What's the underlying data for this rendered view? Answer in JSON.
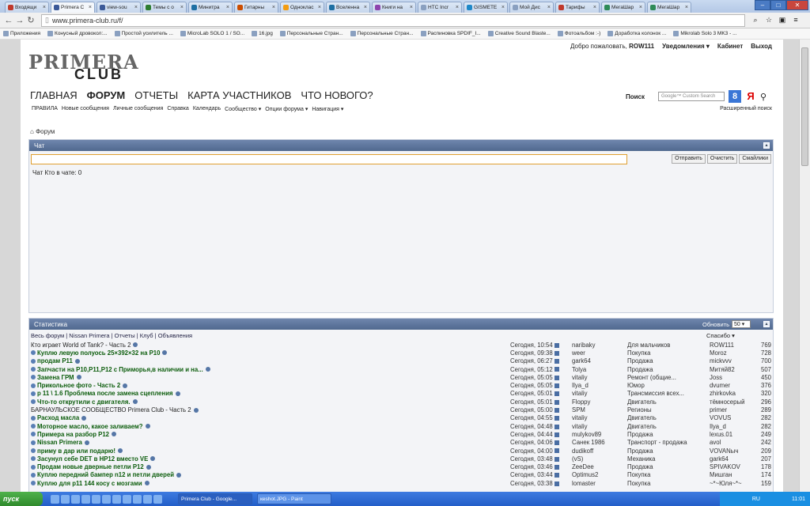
{
  "browser": {
    "tabs": [
      {
        "label": "Входящи",
        "color": "#c0392b"
      },
      {
        "label": "Primera C",
        "color": "#3b5998",
        "active": true
      },
      {
        "label": "view-sou",
        "color": "#3b5998"
      },
      {
        "label": "Темы с о",
        "color": "#2e7d32"
      },
      {
        "label": "Минитра",
        "color": "#1e6fa3"
      },
      {
        "label": "Гитарны",
        "color": "#cc4d00"
      },
      {
        "label": "Одноклас",
        "color": "#f39c12"
      },
      {
        "label": "Вселенна",
        "color": "#1e6fa3"
      },
      {
        "label": "Книги на",
        "color": "#8e44ad"
      },
      {
        "label": "HTC Incr",
        "color": "#8aa0c0"
      },
      {
        "label": "GISMETE",
        "color": "#1e88c8"
      },
      {
        "label": "Мой Дис",
        "color": "#8aa0c0"
      },
      {
        "label": "Тарифы",
        "color": "#c0392b"
      },
      {
        "label": "МегаШар",
        "color": "#2e8b57"
      },
      {
        "label": "МегаШар",
        "color": "#2e8b57"
      }
    ],
    "url": "www.primera-club.ru/f/",
    "bookmarks": [
      "Приложения",
      "Конусный дровокол:...",
      "Простой усилитель ...",
      "MicroLab SOLO 1 / SO...",
      "16.jpg",
      "Персональные Стран...",
      "Персональные Стран...",
      "Распиновка SPDIF_I...",
      "Creative Sound Blaste...",
      "Фотоальбом :-)",
      "Доработка колонок ...",
      "Mikrolab Solo 3 MK3 - ..."
    ]
  },
  "site": {
    "logo_top": "PRIMERA",
    "logo_bottom": "CLUB",
    "welcome": "Добро пожаловать,",
    "username": "ROW111",
    "notifications": "Уведомления ▾",
    "cabinet": "Кабинет",
    "logout": "Выход",
    "main_nav": [
      "ГЛАВНАЯ",
      "ФОРУМ",
      "ОТЧЕТЫ",
      "КАРТА УЧАСТНИКОВ",
      "ЧТО НОВОГО?"
    ],
    "sub_nav": [
      "ПРАВИЛА",
      "Новые сообщения",
      "Личные сообщения",
      "Справка",
      "Календарь",
      "Сообщество ▾",
      "Опции форума ▾",
      "Навигация ▾"
    ],
    "search_label": "Поиск",
    "search_placeholder": "Google™ Custom Search",
    "advanced_search": "Расширенный поиск",
    "breadcrumb": "Форум"
  },
  "chat": {
    "title": "Чат",
    "send": "Отправить",
    "clear": "Очистить",
    "smilies": "Смайлики",
    "info": "Чат     Кто в чате: 0"
  },
  "stats": {
    "title": "Статистика",
    "refresh_label": "Обновить",
    "refresh_value": "50",
    "links": "Весь форум | Nissan Primera | Отчеты | Клуб | Объявления",
    "thanks": "Спасибо ▾",
    "rows": [
      {
        "title": "Кто играет World of Tank? - Часть 2",
        "new": false,
        "date": "Сегодня, 10:54",
        "user": "naribaky",
        "forum": "Для мальчиков",
        "last": "ROW111",
        "count": "769"
      },
      {
        "title": "Куплю левую полуось 25×392×32 на P10",
        "new": true,
        "date": "Сегодня, 09:38",
        "user": "weer",
        "forum": "Покупка",
        "last": "Moroz",
        "count": "728"
      },
      {
        "title": "продам P11",
        "new": true,
        "date": "Сегодня, 06:27",
        "user": "gark64",
        "forum": "Продажа",
        "last": "mickvvv",
        "count": "700"
      },
      {
        "title": "Запчасти на P10,P11,P12 с Приморья,в наличии и на...",
        "new": true,
        "date": "Сегодня, 05:12",
        "user": "Tolya",
        "forum": "Продажа",
        "last": "Митяй82",
        "count": "507"
      },
      {
        "title": "Замена ГРМ",
        "new": true,
        "date": "Сегодня, 05:05",
        "user": "vitaliy",
        "forum": "Ремонт (общие...",
        "last": "Joss",
        "count": "450"
      },
      {
        "title": "Прикольное фото - Часть 2",
        "new": true,
        "date": "Сегодня, 05:05",
        "user": "Ilya_d",
        "forum": "Юмор",
        "last": "dvumer",
        "count": "376"
      },
      {
        "title": "p 11 \\ 1.6 Проблема после замена сцепления",
        "new": true,
        "date": "Сегодня, 05:01",
        "user": "vitaliy",
        "forum": "Трансмиссия всех...",
        "last": "zhirkovka",
        "count": "320"
      },
      {
        "title": "Что-то открутили с двигателя.",
        "new": true,
        "date": "Сегодня, 05:01",
        "user": "Floppy",
        "forum": "Двигатель",
        "last": "тёмносерый",
        "count": "296"
      },
      {
        "title": "БАРНАУЛЬСКОЕ СООБЩЕСТВО Primera Club - Часть 2",
        "new": false,
        "date": "Сегодня, 05:00",
        "user": "SPM",
        "forum": "Регионы",
        "last": "primer",
        "count": "289"
      },
      {
        "title": "Расход масла",
        "new": true,
        "date": "Сегодня, 04:55",
        "user": "vitaliy",
        "forum": "Двигатель",
        "last": "VOVUS",
        "count": "282"
      },
      {
        "title": "Моторное масло, какое заливаем?",
        "new": true,
        "date": "Сегодня, 04:48",
        "user": "vitaliy",
        "forum": "Двигатель",
        "last": "Ilya_d",
        "count": "282"
      },
      {
        "title": "Примера на разбор P12",
        "new": true,
        "date": "Сегодня, 04:44",
        "user": "mulykov89",
        "forum": "Продажа",
        "last": "lexus.01",
        "count": "249"
      },
      {
        "title": "Nissan Primera",
        "new": true,
        "date": "Сегодня, 04:06",
        "user": "Санек 1986",
        "forum": "Транспорт - продажа",
        "last": "avol",
        "count": "242"
      },
      {
        "title": "приму в дар или подарю!",
        "new": true,
        "date": "Сегодня, 04:00",
        "user": "dudikoff",
        "forum": "Продажа",
        "last": "VOVANыч",
        "count": "209"
      },
      {
        "title": "Засунул себе DET в HP12 вместо VE",
        "new": true,
        "date": "Сегодня, 03:48",
        "user": "(vS)",
        "forum": "Механика",
        "last": "gark64",
        "count": "207"
      },
      {
        "title": "Продам новые дверные петли P12",
        "new": true,
        "date": "Сегодня, 03:46",
        "user": "ZeeDee",
        "forum": "Продажа",
        "last": "SPIVAKOV",
        "count": "178"
      },
      {
        "title": "Куплю передний бампер n12 и петли дверей",
        "new": true,
        "date": "Сегодня, 03:44",
        "user": "Optimus2",
        "forum": "Покупка",
        "last": "Мишган",
        "count": "174"
      },
      {
        "title": "Куплю для p11 144 косу с мозгами",
        "new": true,
        "date": "Сегодня, 03:38",
        "user": "lomaster",
        "forum": "Покупка",
        "last": "~*~Юля~*~",
        "count": "159"
      }
    ]
  },
  "taskbar": {
    "start": "пуск",
    "tasks": [
      "Primera Club - Google...",
      "кеshot.JPG - Paint"
    ],
    "lang": "RU",
    "clock": "11:01"
  }
}
